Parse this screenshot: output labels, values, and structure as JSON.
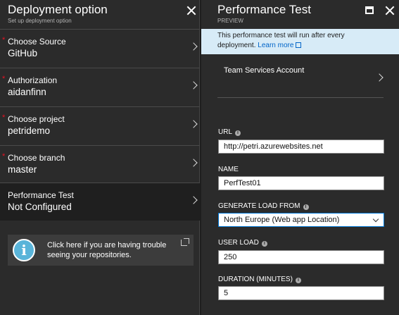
{
  "left_panel": {
    "title": "Deployment option",
    "subtitle": "Set up deployment option",
    "items": [
      {
        "label": "Choose Source",
        "value": "GitHub",
        "required": true
      },
      {
        "label": "Authorization",
        "value": "aidanfinn",
        "required": true
      },
      {
        "label": "Choose project",
        "value": "petridemo",
        "required": true
      },
      {
        "label": "Choose branch",
        "value": "master",
        "required": true
      },
      {
        "label": "Performance Test",
        "value": "Not Configured",
        "required": false
      }
    ],
    "required_marker": "*",
    "help_text": "Click here if you are having trouble seeing your repositories."
  },
  "right_panel": {
    "title": "Performance Test",
    "subtitle": "PREVIEW",
    "banner_text": "This performance test will run after every deployment.",
    "banner_link": "Learn more",
    "team_services_label": "Team Services Account",
    "fields": {
      "url_label": "URL",
      "url_value": "http://petri.azurewebsites.net",
      "name_label": "NAME",
      "name_value": "PerfTest01",
      "load_label": "GENERATE LOAD FROM",
      "load_value": "North Europe (Web app Location)",
      "user_load_label": "USER LOAD",
      "user_load_value": "250",
      "duration_label": "DURATION (MINUTES)",
      "duration_value": "5"
    }
  },
  "colors": {
    "panel_bg": "#2b2b2b",
    "banner_bg": "#d7ebf7",
    "link": "#0064c8",
    "info_icon": "#59b4d9",
    "required": "#e81123"
  },
  "icons": {
    "close": "close-icon",
    "maximize": "maximize-icon",
    "chevron": "chevron-right-icon",
    "info": "info-icon",
    "external": "external-link-icon"
  }
}
